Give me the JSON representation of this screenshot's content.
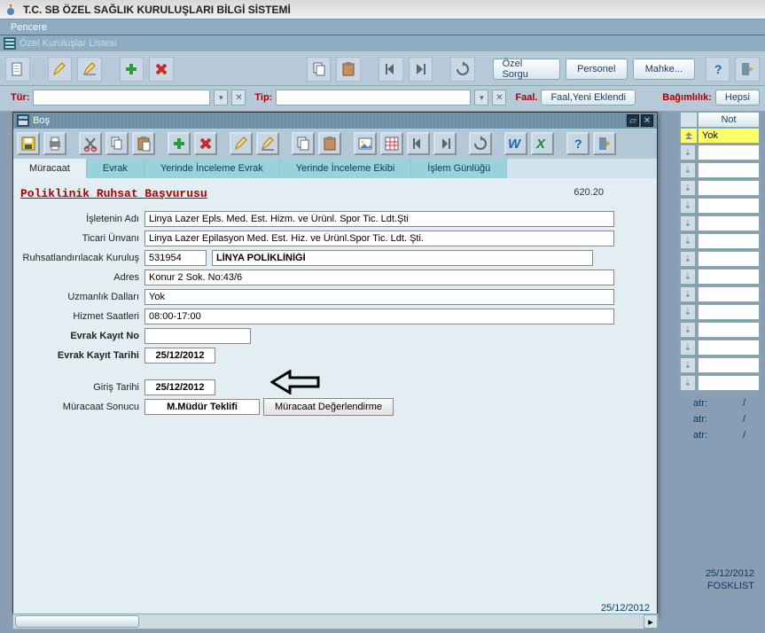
{
  "app": {
    "title": "T.C. SB ÖZEL SAĞLIK KURULUŞLARI BİLGİ SİSTEMİ",
    "menu_pencere": "Pencere",
    "sub_window_title": "Özel Kuruluşlar Listesi"
  },
  "main_toolbar": {
    "ozel_sorgu": "Özel Sorgu",
    "personel": "Personel",
    "mahke": "Mahke..."
  },
  "filters": {
    "tur_label": "Tür:",
    "tur_value": "",
    "tip_label": "Tip:",
    "tip_value": "",
    "faal_label": "Faal.",
    "faal_value": "Faal,Yeni Eklendi",
    "bagimlilik_label": "Bağımlılık:",
    "bagimlilik_value": "Hepsi"
  },
  "right": {
    "header_not": "Not",
    "yok": "Yok",
    "info_atr": "atr:",
    "info_slash": "/",
    "date1": "25/12/2012",
    "code": "FOSKLIST"
  },
  "inner": {
    "title": "Boş",
    "tabs": {
      "muracaat": "Müracaat",
      "evrak": "Evrak",
      "yerinde_inceleme_evrak": "Yerinde İnceleme Evrak",
      "yerinde_inceleme_ekibi": "Yerinde İnceleme Ekibi",
      "islem_gunlugu": "İşlem Günlüğü"
    },
    "form": {
      "title": "Poliklinik Ruhsat Başvurusu",
      "code": "620.20",
      "labels": {
        "isletenin_adi": "İşletenin Adı",
        "ticari_unvani": "Ticari Ünvanı",
        "ruhsat_kurulus": "Ruhsatlandırılacak Kuruluş",
        "adres": "Adres",
        "uzmanlik": "Uzmanlık Dalları",
        "hizmet_saatleri": "Hizmet Saatleri",
        "evrak_kayit_no": "Evrak Kayıt No",
        "evrak_kayit_tarihi": "Evrak Kayıt Tarihi",
        "giris_tarihi": "Giriş Tarihi",
        "muracaat_sonucu": "Müracaat Sonucu"
      },
      "values": {
        "isletenin_adi": "Linya Lazer Epls. Med. Est. Hizm. ve Ürünl. Spor Tic. Ldt.Şti",
        "ticari_unvani": "Linya Lazer Epilasyon Med. Est. Hiz. ve Ürünl.Spor Tic. Ldt. Şti.",
        "ruhsat_kod": "531954",
        "ruhsat_ad": "LİNYA POLİKLİNİĞİ",
        "adres": "Konur 2 Sok. No:43/6",
        "uzmanlik": "Yok",
        "hizmet_saatleri": "08:00-17:00",
        "evrak_kayit_no": "",
        "evrak_kayit_tarihi": "25/12/2012",
        "giris_tarihi": "25/12/2012",
        "muracaat_sonucu": "M.Müdür Teklifi"
      },
      "buttons": {
        "muracaat_degerlendirme": "Müracaat Değerlendirme"
      }
    }
  },
  "footer": {
    "date": "25/12/2012"
  }
}
